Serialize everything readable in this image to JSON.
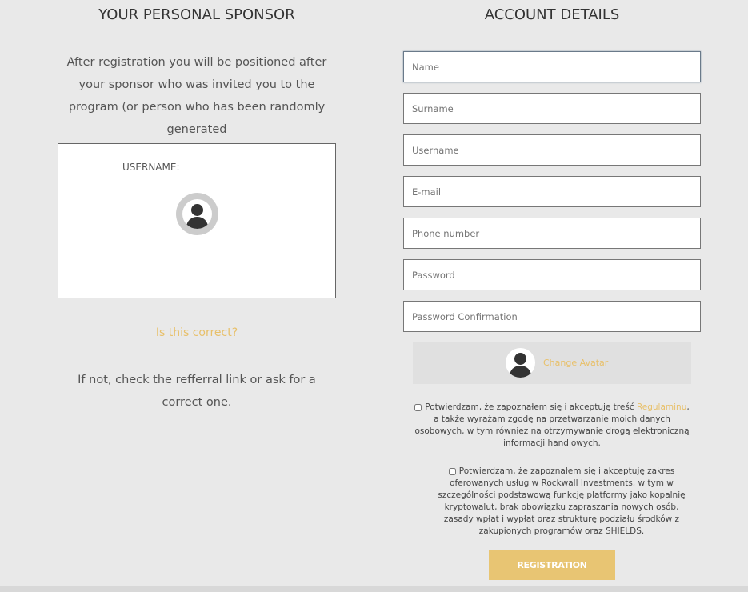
{
  "sponsor": {
    "title": "YOUR PERSONAL SPONSOR",
    "intro": "After registration you will be positioned after your sponsor who was invited you to the program (or person who has been randomly generated",
    "username_label": "USERNAME:",
    "correct": "Is this correct?",
    "if_not": "If not, check the refferral link or ask for a correct one."
  },
  "account": {
    "title": "ACCOUNT DETAILS",
    "fields": [
      {
        "placeholder": "Name"
      },
      {
        "placeholder": "Surname"
      },
      {
        "placeholder": "Username"
      },
      {
        "placeholder": "E-mail"
      },
      {
        "placeholder": "Phone number"
      },
      {
        "placeholder": "Password"
      },
      {
        "placeholder": "Password Confirmation"
      }
    ],
    "change_avatar": "Change Avatar",
    "consent1_pre": "Potwierdzam, że zapoznałem się i akceptuję treść ",
    "consent1_link": "Regulaminu",
    "consent1_post": ", a także wyrażam zgodę na przetwarzanie moich danych osobowych, w tym również na otrzymywanie drogą elektroniczną informacji handlowych.",
    "consent2": "Potwierdzam, że zapoznałem się i akceptuję zakres oferowanych usług w Rockwall Investments, w tym w szczególności podstawową funkcję platformy jako kopalnię kryptowalut, brak obowiązku zapraszania nowych osób, zasady wpłat i wypłat oraz strukturę podziału środków z zakupionych programów oraz SHIELDS.",
    "register": "REGISTRATION"
  },
  "colors": {
    "accent": "#e8c06a",
    "button": "#e8c573"
  }
}
